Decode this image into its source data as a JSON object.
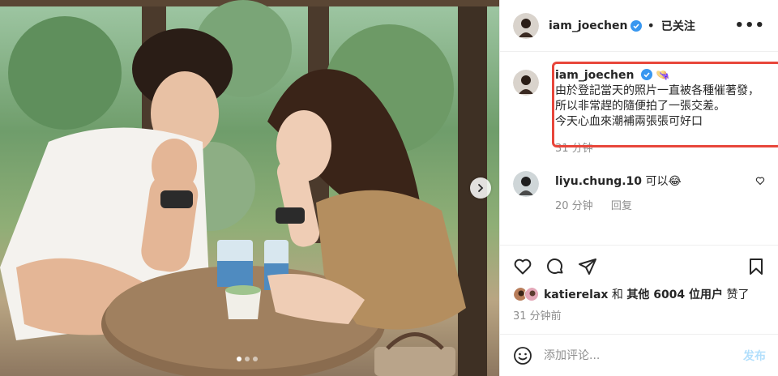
{
  "post": {
    "username": "iam_joechen",
    "follow_status": "已关注",
    "more_label": "•••",
    "caption_emoji": "👒",
    "caption_text": "由於登記當天的照片一直被各種催著發，所以非常趕的隨便拍了一張交差。\n今天心血來潮補兩張張可好口",
    "caption_time": "31 分钟"
  },
  "comments": [
    {
      "username": "liyu.chung.10",
      "text": "可以😂",
      "time": "20 分钟",
      "reply_label": "回复"
    }
  ],
  "likes": {
    "first_user": "katierelax",
    "conjunction": " 和 ",
    "others": "其他 6004 位用户",
    "suffix": " 赞了"
  },
  "post_time": "31 分钟前",
  "add_comment": {
    "placeholder": "添加评论...",
    "post_label": "发布"
  },
  "icons": {
    "verified": "verified-badge-icon",
    "heart": "heart-icon",
    "comment": "comment-icon",
    "share": "share-icon",
    "bookmark": "bookmark-icon",
    "emoji": "emoji-icon",
    "next": "chevron-right-icon"
  },
  "colors": {
    "verified_blue": "#3897f0",
    "highlight_red": "#e8463b",
    "muted_text": "#8e8e8e",
    "post_button": "#b2dffc"
  },
  "carousel": {
    "total": 3,
    "active": 1
  }
}
